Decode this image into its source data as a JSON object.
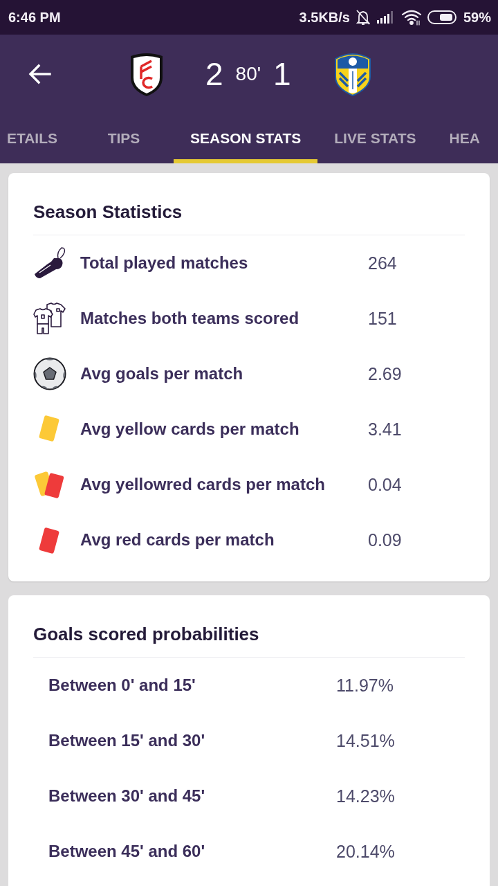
{
  "status_bar": {
    "time": "6:46 PM",
    "network_speed": "3.5KB/s",
    "battery": "59%"
  },
  "match_header": {
    "home_score": "2",
    "minute": "80'",
    "away_score": "1"
  },
  "tabs": [
    {
      "label": "ETAILS",
      "selected": false
    },
    {
      "label": "TIPS",
      "selected": false
    },
    {
      "label": "SEASON STATS",
      "selected": true
    },
    {
      "label": "LIVE STATS",
      "selected": false
    },
    {
      "label": "HEA",
      "selected": false
    }
  ],
  "season_statistics": {
    "title": "Season Statistics",
    "rows": [
      {
        "kind": "whistle",
        "label": "Total played matches",
        "value": "264"
      },
      {
        "kind": "jerseys",
        "label": "Matches both teams scored",
        "value": "151"
      },
      {
        "kind": "ball",
        "label": "Avg goals per match",
        "value": "2.69"
      },
      {
        "kind": "yellow_card",
        "label": "Avg yellow cards per match",
        "value": "3.41"
      },
      {
        "kind": "yellowred_card",
        "label": "Avg yellowred cards per match",
        "value": "0.04"
      },
      {
        "kind": "red_card",
        "label": "Avg red cards per match",
        "value": "0.09"
      }
    ]
  },
  "goals_scored_probabilities": {
    "title": "Goals scored probabilities",
    "rows": [
      {
        "label": "Between 0' and 15'",
        "value": "11.97%"
      },
      {
        "label": "Between 15' and 30'",
        "value": "14.51%"
      },
      {
        "label": "Between 30' and 45'",
        "value": "14.23%"
      },
      {
        "label": "Between 45' and 60'",
        "value": "20.14%"
      }
    ]
  }
}
